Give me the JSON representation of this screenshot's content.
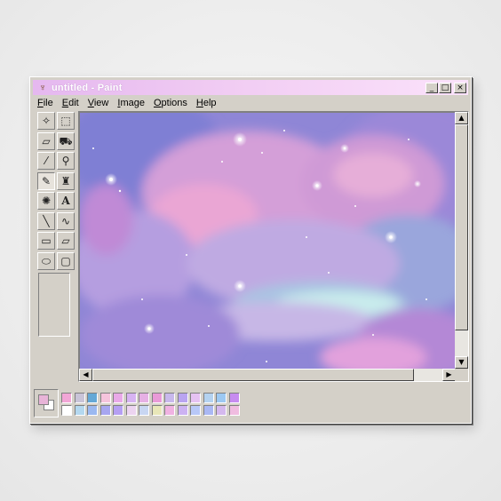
{
  "window": {
    "title": "untitled - Paint",
    "app_icon": "paint-brush-icon",
    "buttons": {
      "minimize": "_",
      "maximize": "□",
      "close": "×"
    }
  },
  "menu": [
    {
      "label": "File",
      "key": "F",
      "rest": "ile"
    },
    {
      "label": "Edit",
      "key": "E",
      "rest": "dit"
    },
    {
      "label": "View",
      "key": "V",
      "rest": "iew"
    },
    {
      "label": "Image",
      "key": "I",
      "rest": "mage"
    },
    {
      "label": "Options",
      "key": "O",
      "rest": "ptions"
    },
    {
      "label": "Help",
      "key": "H",
      "rest": "elp"
    }
  ],
  "tools": [
    {
      "name": "free-form-select-icon",
      "glyph": "✧"
    },
    {
      "name": "rect-select-icon",
      "glyph": "⬚"
    },
    {
      "name": "eraser-icon",
      "glyph": "▱"
    },
    {
      "name": "fill-bucket-icon",
      "glyph": "⛟"
    },
    {
      "name": "color-picker-icon",
      "glyph": "⁄"
    },
    {
      "name": "magnifier-icon",
      "glyph": "⚲"
    },
    {
      "name": "pencil-icon",
      "glyph": "✎",
      "active": true
    },
    {
      "name": "brush-icon",
      "glyph": "♜"
    },
    {
      "name": "airbrush-icon",
      "glyph": "✺"
    },
    {
      "name": "text-icon",
      "glyph": "A"
    },
    {
      "name": "line-icon",
      "glyph": "╲"
    },
    {
      "name": "curve-icon",
      "glyph": "∿"
    },
    {
      "name": "rectangle-icon",
      "glyph": "▭"
    },
    {
      "name": "polygon-icon",
      "glyph": "▱"
    },
    {
      "name": "ellipse-icon",
      "glyph": "⬭"
    },
    {
      "name": "rounded-rect-icon",
      "glyph": "▢"
    }
  ],
  "colors": {
    "foreground": "#e8b4d8",
    "background": "#ffffff",
    "accent_title": "#e5b8ef"
  },
  "palette": {
    "row1": [
      "#f2a6d6",
      "#c9c4d8",
      "#64a8d6",
      "#f6c4dc",
      "#e9a9e8",
      "#d7b3f2",
      "#e6b0e4",
      "#e99ad8",
      "#c8b8ec",
      "#b9a4f0",
      "#e6c2f2",
      "#b4d2f0",
      "#9cc8f2",
      "#c78cf0"
    ],
    "row2": [
      "#ffffff",
      "#b4d8ef",
      "#9bb8f0",
      "#a7a6f0",
      "#b59ff2",
      "#ecd4f0",
      "#c8d6f2",
      "#e8e6b8",
      "#f0b2e2",
      "#ccb2f2",
      "#b8c8f8",
      "#aab8f4",
      "#d4b8ee",
      "#f0bce0"
    ]
  }
}
